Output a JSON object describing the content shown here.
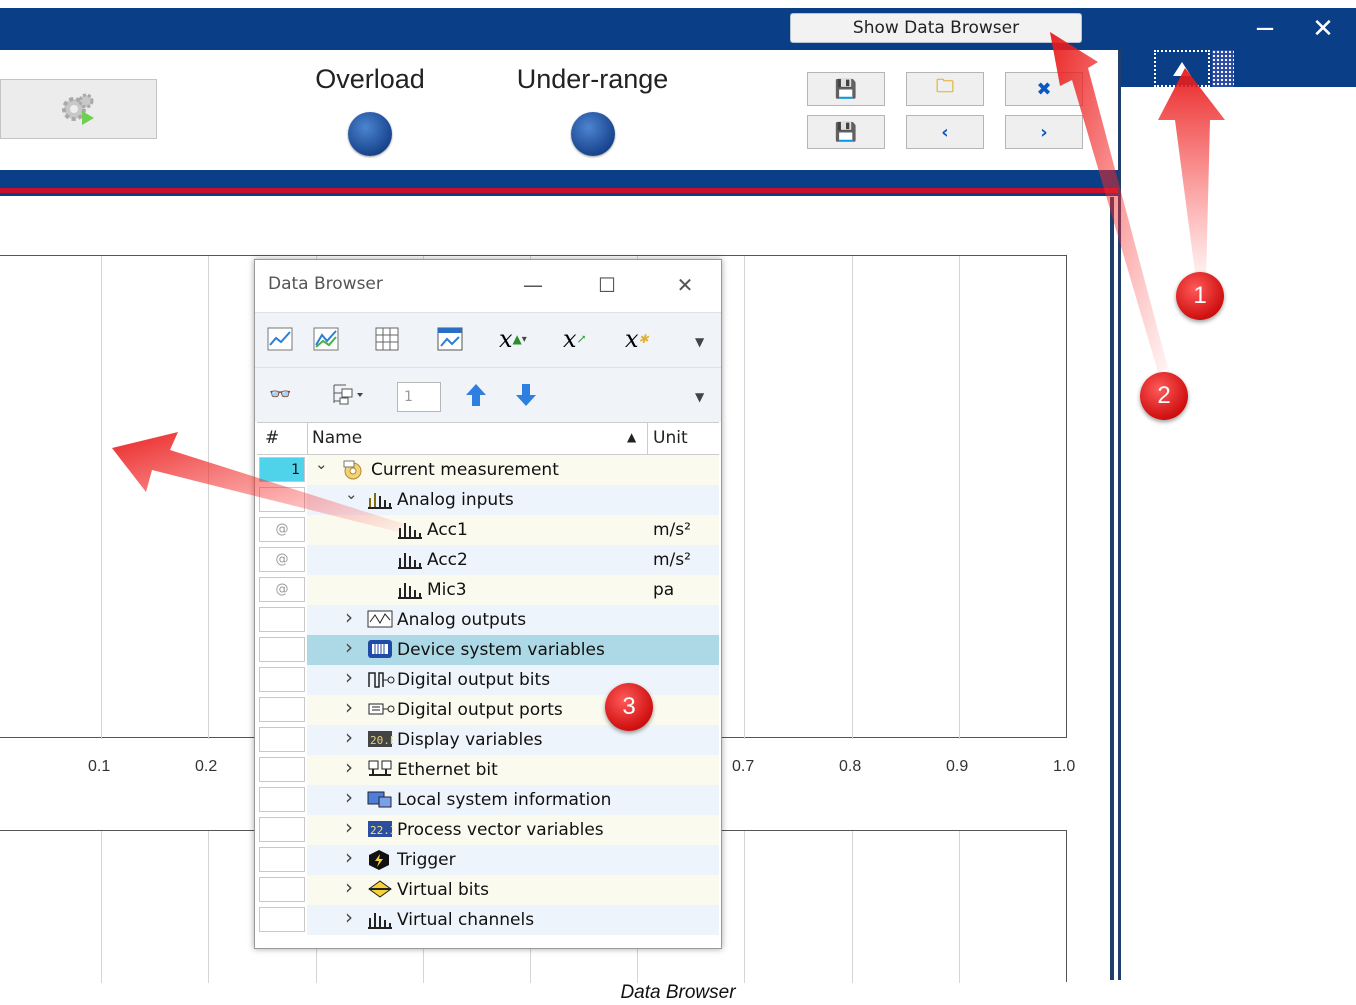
{
  "header": {
    "show_data_browser_label": "Show Data Browser",
    "minimize_label": "−",
    "close_label": "✕"
  },
  "indicators": {
    "overload_label": "Overload",
    "under_range_label": "Under-range"
  },
  "plot": {
    "x_ticks": [
      "0.1",
      "0.2",
      "0.7",
      "0.8",
      "0.9",
      "1.0"
    ]
  },
  "data_browser": {
    "title": "Data Browser",
    "index_value": "1",
    "columns": {
      "num": "#",
      "name": "Name",
      "unit": "Unit"
    },
    "rows": [
      {
        "num": "1",
        "name": "Current measurement",
        "unit": "",
        "level": 0,
        "expanded": true,
        "icon": "measurement-icon"
      },
      {
        "num": "",
        "name": "Analog inputs",
        "unit": "",
        "level": 1,
        "expanded": true,
        "icon": "analog-inputs-icon"
      },
      {
        "num": "@",
        "name": "Acc1",
        "unit": "m/s²",
        "level": 2,
        "icon": "channel-icon"
      },
      {
        "num": "@",
        "name": "Acc2",
        "unit": "m/s²",
        "level": 2,
        "icon": "channel-icon"
      },
      {
        "num": "@",
        "name": "Mic3",
        "unit": "pa",
        "level": 2,
        "icon": "channel-icon"
      },
      {
        "num": "",
        "name": "Analog outputs",
        "unit": "",
        "level": 1,
        "icon": "analog-outputs-icon"
      },
      {
        "num": "",
        "name": "Device system variables",
        "unit": "",
        "level": 1,
        "icon": "device-system-icon",
        "selected": true
      },
      {
        "num": "",
        "name": "Digital output bits",
        "unit": "",
        "level": 1,
        "icon": "digital-bits-icon"
      },
      {
        "num": "",
        "name": "Digital output ports",
        "unit": "",
        "level": 1,
        "icon": "digital-ports-icon"
      },
      {
        "num": "",
        "name": "Display variables",
        "unit": "",
        "level": 1,
        "icon": "display-variables-icon"
      },
      {
        "num": "",
        "name": "Ethernet bit",
        "unit": "",
        "level": 1,
        "icon": "ethernet-icon"
      },
      {
        "num": "",
        "name": "Local system information",
        "unit": "",
        "level": 1,
        "icon": "local-system-icon"
      },
      {
        "num": "",
        "name": "Process vector variables",
        "unit": "",
        "level": 1,
        "icon": "process-vector-icon"
      },
      {
        "num": "",
        "name": "Trigger",
        "unit": "",
        "level": 1,
        "icon": "trigger-icon"
      },
      {
        "num": "",
        "name": "Virtual bits",
        "unit": "",
        "level": 1,
        "icon": "virtual-bits-icon"
      },
      {
        "num": "",
        "name": "Virtual channels",
        "unit": "",
        "level": 1,
        "icon": "virtual-channels-icon"
      }
    ]
  },
  "annotations": {
    "badge1": "1",
    "badge2": "2",
    "badge3": "3"
  },
  "caption": "Data Browser",
  "colors": {
    "title_bar": "#0a3e86",
    "accent_red": "#c8102e",
    "selected_row": "#add8e6"
  }
}
